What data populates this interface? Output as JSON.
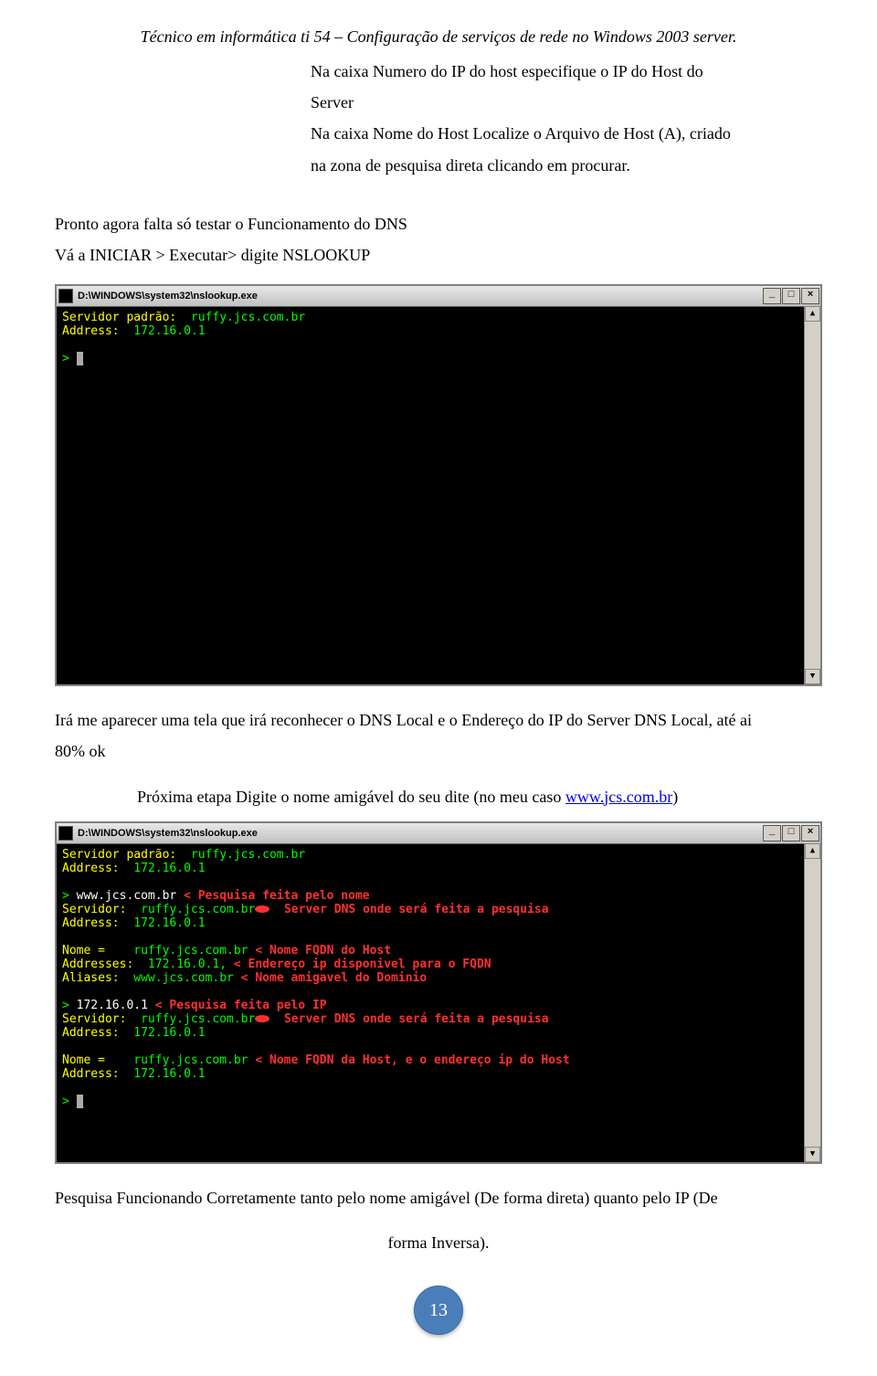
{
  "header": "Técnico em informática ti 54 – Configuração de serviços de rede no Windows 2003 server.",
  "indent": {
    "l1": "Na caixa Numero do IP do host especifique o IP do Host do",
    "l2": "Server",
    "l3": "Na caixa Nome do Host Localize o Arquivo de Host (A), criado",
    "l4": "na zona de pesquisa direta clicando em procurar."
  },
  "p1": "Pronto agora falta só testar o Funcionamento do DNS",
  "p2": "Vá a INICIAR > Executar> digite NSLOOKUP",
  "term_title": "D:\\WINDOWS\\system32\\nslookup.exe",
  "t1": {
    "l1a": "Servidor padrão:  ",
    "l1b": "ruffy.jcs.com.br",
    "l2a": "Address:  ",
    "l2b": "172.16.0.1",
    "prompt": "> "
  },
  "mid1": "Irá me aparecer uma tela que irá reconhecer o DNS Local e o Endereço do IP do Server DNS Local, até ai",
  "mid2": "80% ok",
  "mid3a": "Próxima etapa Digite o nome amigável do seu dite (no meu caso ",
  "mid3b": "www.jcs.com.br",
  "mid3c": ")",
  "t2": {
    "l1a": "Servidor padrão:  ",
    "l1b": "ruffy.jcs.com.br",
    "l2a": "Address:  ",
    "l2b": "172.16.0.1",
    "l3a": "> ",
    "l3b": "www.jcs.com.br",
    "l3c": " < Pesquisa feita pelo nome",
    "l4a": "Servidor:  ",
    "l4b": "ruffy.jcs.com.br",
    "l4c": "  Server DNS onde será feita a pesquisa",
    "l5a": "Address:  ",
    "l5b": "172.16.0.1",
    "l6a": "Nome =    ",
    "l6b": "ruffy.jcs.com.br",
    "l6c": " < Nome FQDN do Host",
    "l7a": "Addresses:  ",
    "l7b": "172.16.0.1,",
    "l7c": " < Endereço ip disponivel para o FQDN",
    "l8a": "Aliases:  ",
    "l8b": "www.jcs.com.br",
    "l8c": " < Nome amigavel do Dominio",
    "l9a": "> ",
    "l9b": "172.16.0.1",
    "l9c": " < Pesquisa feita pelo IP",
    "l10a": "Servidor:  ",
    "l10b": "ruffy.jcs.com.br",
    "l10c": "  Server DNS onde será feita a pesquisa",
    "l11a": "Address:  ",
    "l11b": "172.16.0.1",
    "l12a": "Nome =    ",
    "l12b": "ruffy.jcs.com.br",
    "l12c": " < Nome FQDN da Host, e o endereço ip do Host",
    "l13a": "Address:  ",
    "l13b": "172.16.0.1",
    "l14": "> "
  },
  "foot1": "Pesquisa Funcionando Corretamente tanto pelo nome amigável (De forma direta) quanto pelo IP (De",
  "foot2": "forma Inversa).",
  "page_number": "13",
  "win_btn_min": "_",
  "win_btn_max": "□",
  "win_btn_close": "×",
  "scroll_up": "▲",
  "scroll_down": "▼"
}
